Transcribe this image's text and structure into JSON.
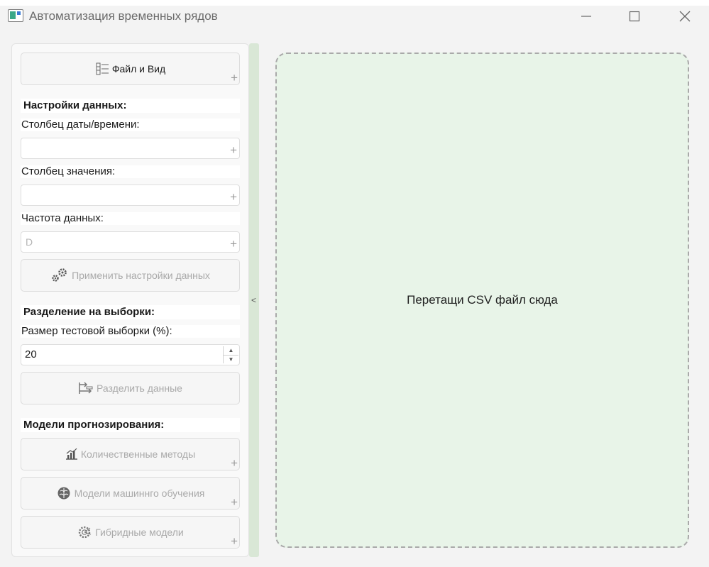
{
  "window": {
    "title": "Автоматизация временных рядов",
    "buttons": {
      "minimize": "—",
      "maximize": "☐",
      "close": "✕"
    }
  },
  "sidebar": {
    "file_view_button": "Файл и Вид",
    "data_settings_header": "Настройки данных:",
    "date_column_label": "Столбец даты/времени:",
    "date_column_value": "",
    "value_column_label": "Столбец значения:",
    "value_column_value": "",
    "frequency_label": "Частота данных:",
    "frequency_value": "D",
    "apply_settings_button": "Применить настройки данных",
    "split_header": "Разделение на выборки:",
    "test_size_label": "Размер тестовой выборки (%):",
    "test_size_value": "20",
    "split_button": "Разделить данные",
    "models_header": "Модели прогнозирования:",
    "quantitative_button": "Количественные методы",
    "ml_button": "Модели машиннго обучения",
    "hybrid_button": "Гибридные модели",
    "expand_symbol": "+"
  },
  "splitter": {
    "collapse_symbol": "<"
  },
  "dropzone": {
    "text": "Перетащи CSV файл сюда"
  },
  "colors": {
    "dropzone_bg": "#e8f4e8",
    "splitter_bg": "#d9e7d6",
    "disabled_text": "#a9a9a9"
  }
}
